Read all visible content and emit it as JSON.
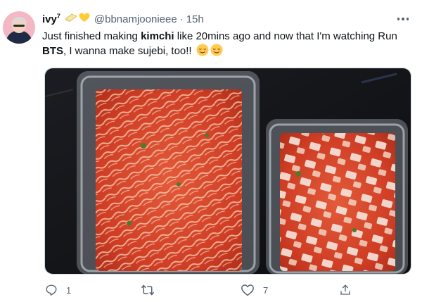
{
  "tweet": {
    "display_name": "ivy",
    "display_name_sup": "7",
    "handle": "@bbnamjoonieee",
    "separator": "·",
    "time": "15h",
    "text_part1": "Just finished making ",
    "text_bold1": "kimchi",
    "text_part2": " like 20mins ago and now that I'm watching Run ",
    "text_bold2": "BTS",
    "text_part3": ", I wanna make sujebi, too!!",
    "emoji_icons": [
      "relieved-face-icon",
      "relieved-face-icon"
    ],
    "name_emoji_icons": [
      "butter-icon",
      "yellow-heart-icon"
    ]
  },
  "actions": {
    "reply_count": "1",
    "retweet_count": "",
    "like_count": "7",
    "share_count": ""
  },
  "colors": {
    "text_primary": "#0f1419",
    "text_secondary": "#536471",
    "border": "#cfd9de",
    "kimchi_red": "#d2452a"
  }
}
